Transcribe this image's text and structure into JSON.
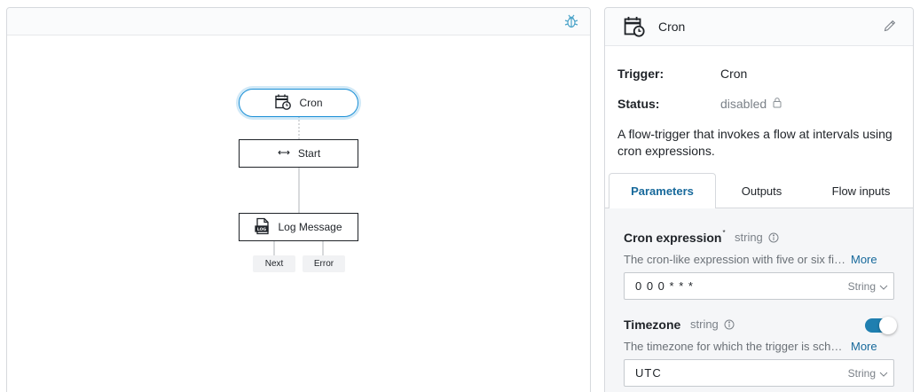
{
  "canvas": {
    "debug_icon": "bug-icon",
    "nodes": {
      "cron": {
        "label": "Cron",
        "icon": "calendar-clock-icon"
      },
      "start": {
        "label": "Start",
        "icon": "double-arrow-icon"
      },
      "log": {
        "label": "Log Message",
        "icon": "log-file-icon"
      }
    },
    "handles": {
      "next": "Next",
      "error": "Error"
    }
  },
  "panel": {
    "title": "Cron",
    "icon": "calendar-clock-icon",
    "edit_icon": "pencil-icon",
    "trigger_label": "Trigger:",
    "trigger_value": "Cron",
    "status_label": "Status:",
    "status_value": "disabled",
    "status_icon": "lock-icon",
    "description": "A flow-trigger that invokes a flow at intervals using cron expressions.",
    "tabs": [
      "Parameters",
      "Outputs",
      "Flow inputs"
    ],
    "active_tab": "Parameters",
    "params": {
      "cron": {
        "name": "Cron expression",
        "required_mark": "*",
        "type": "string",
        "description": "The cron-like expression with five or six fields",
        "more": "More",
        "value": "0 0 0 * * *",
        "value_type": "String"
      },
      "timezone": {
        "name": "Timezone",
        "type": "string",
        "description": "The timezone for which the trigger is scheduled",
        "more": "More",
        "enabled": true,
        "value": "UTC",
        "value_type": "String"
      }
    }
  },
  "colors": {
    "accent": "#17699b",
    "selection": "#1a8fd6",
    "toggle": "#1f7fb0"
  }
}
